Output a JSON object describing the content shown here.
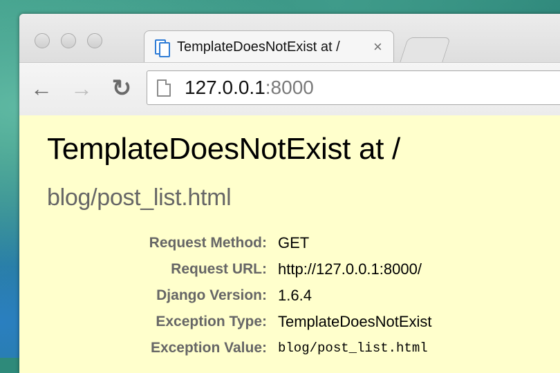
{
  "browser": {
    "tab": {
      "title": "TemplateDoesNotExist at /",
      "close_glyph": "×",
      "favicon": "django-pages-icon"
    },
    "nav": {
      "back_glyph": "←",
      "forward_glyph": "→",
      "reload_glyph": "↻"
    },
    "address_bar": {
      "host": "127.0.0.1",
      "port": ":8000",
      "page_icon": "page-icon"
    }
  },
  "page": {
    "title": "TemplateDoesNotExist at /",
    "subtitle": "blog/post_list.html",
    "meta": [
      {
        "label": "Request Method:",
        "value": "GET"
      },
      {
        "label": "Request URL:",
        "value": "http://127.0.0.1:8000/"
      },
      {
        "label": "Django Version:",
        "value": "1.6.4"
      },
      {
        "label": "Exception Type:",
        "value": "TemplateDoesNotExist"
      },
      {
        "label": "Exception Value:",
        "value": "blog/post_list.html"
      }
    ]
  },
  "colors": {
    "page_background": "#ffffcc",
    "label_gray": "#666666",
    "favicon_blue": "#2d7bd6"
  }
}
